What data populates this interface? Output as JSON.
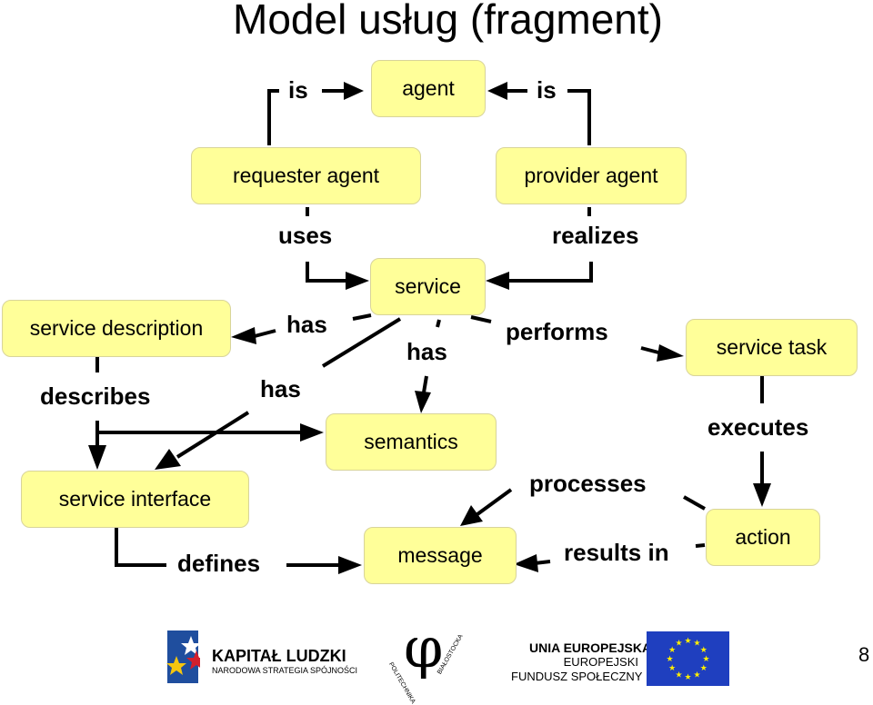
{
  "title": "Model usług (fragment)",
  "nodes": {
    "agent": "agent",
    "requester_agent": "requester agent",
    "provider_agent": "provider agent",
    "service": "service",
    "service_description": "service description",
    "service_task": "service task",
    "semantics": "semantics",
    "service_interface": "service interface",
    "message": "message",
    "action": "action"
  },
  "relations": {
    "is_left": "is",
    "is_right": "is",
    "uses": "uses",
    "realizes": "realizes",
    "has_description": "has",
    "has_semantics": "has",
    "has_interface": "has",
    "performs": "performs",
    "describes": "describes",
    "executes": "executes",
    "processes": "processes",
    "defines": "defines",
    "results_in": "results in"
  },
  "footer": {
    "kapital_title": "KAPITAŁ LUDZKI",
    "kapital_subtitle": "NARODOWA STRATEGIA SPÓJNOŚCI",
    "politechnika_symbol": "φ",
    "politechnika_arc_left": "POLITECHNIKA",
    "politechnika_arc_right": "BIAŁOSTOCKA",
    "eu_line1": "UNIA EUROPEJSKA",
    "eu_line2": "EUROPEJSKI",
    "eu_line3": "FUNDUSZ SPOŁECZNY",
    "page_number": "8"
  },
  "colors": {
    "node_fill": "#ffff99",
    "eu_flag": "#1f3fbf",
    "eu_star": "#ffee00"
  }
}
